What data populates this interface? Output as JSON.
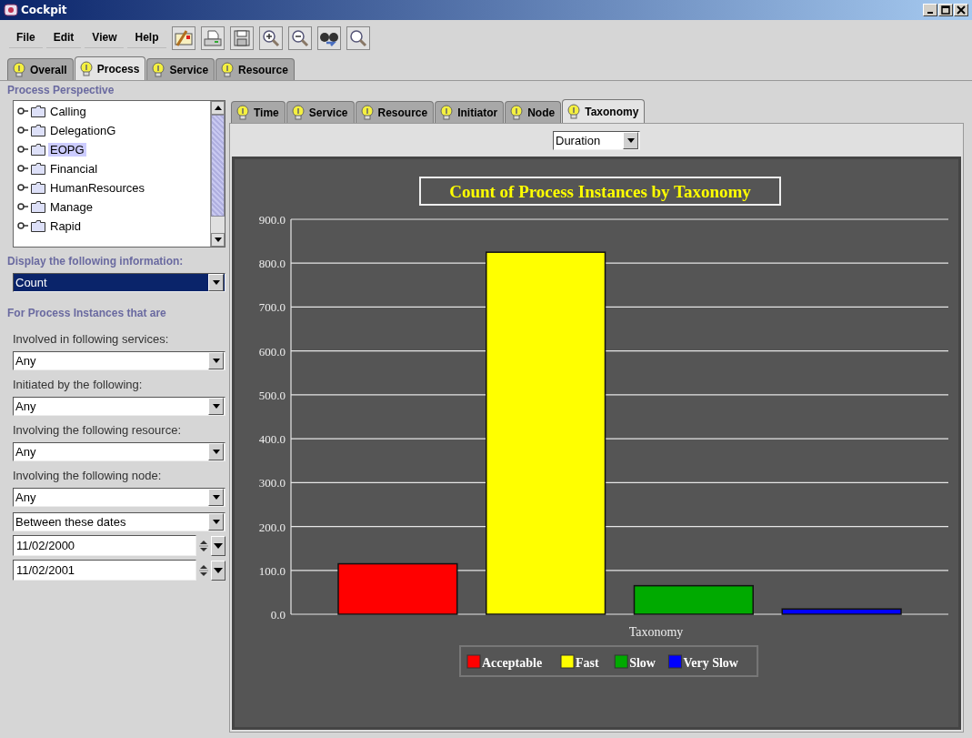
{
  "window": {
    "title": "Cockpit"
  },
  "menu": [
    "File",
    "Edit",
    "View",
    "Help"
  ],
  "tabs": [
    {
      "label": "Overall",
      "selected": false
    },
    {
      "label": "Process",
      "selected": true
    },
    {
      "label": "Service",
      "selected": false
    },
    {
      "label": "Resource",
      "selected": false
    }
  ],
  "perspective": {
    "title": "Process Perspective",
    "items": [
      {
        "label": "Calling",
        "selected": false
      },
      {
        "label": "DelegationG",
        "selected": false
      },
      {
        "label": "EOPG",
        "selected": true
      },
      {
        "label": "Financial",
        "selected": false
      },
      {
        "label": "HumanResources",
        "selected": false
      },
      {
        "label": "Manage",
        "selected": false
      },
      {
        "label": "Rapid",
        "selected": false
      }
    ]
  },
  "display": {
    "label": "Display the following information:",
    "value": "Count"
  },
  "filters": {
    "title": "For Process Instances that are",
    "fields": [
      {
        "kind": "combo",
        "label": "Involved in following services:",
        "value": "Any"
      },
      {
        "kind": "combo",
        "label": "Initiated by the following:",
        "value": "Any"
      },
      {
        "kind": "combo",
        "label": "Involving the following resource:",
        "value": "Any"
      },
      {
        "kind": "combo",
        "label": "Involving the following node:",
        "value": "Any"
      },
      {
        "kind": "combo",
        "value": "Between these dates"
      },
      {
        "kind": "date",
        "value": "11/02/2000"
      },
      {
        "kind": "date",
        "value": "11/02/2001"
      }
    ]
  },
  "subtabs": [
    {
      "label": "Time",
      "selected": false
    },
    {
      "label": "Service",
      "selected": false
    },
    {
      "label": "Resource",
      "selected": false
    },
    {
      "label": "Initiator",
      "selected": false
    },
    {
      "label": "Node",
      "selected": false
    },
    {
      "label": "Taxonomy",
      "selected": true
    }
  ],
  "measure": {
    "value": "Duration"
  },
  "chart_data": {
    "type": "bar",
    "grid": true,
    "legend": true,
    "title": "Count of Process Instances by Taxonomy",
    "xlabel": "Taxonomy",
    "ylim": [
      0,
      900
    ],
    "yticks": [
      {
        "value": 0,
        "label": "0.0"
      },
      {
        "value": 100,
        "label": "100.0"
      },
      {
        "value": 200,
        "label": "200.0"
      },
      {
        "value": 300,
        "label": "300.0"
      },
      {
        "value": 400,
        "label": "400.0"
      },
      {
        "value": 500,
        "label": "500.0"
      },
      {
        "value": 600,
        "label": "600.0"
      },
      {
        "value": 700,
        "label": "700.0"
      },
      {
        "value": 800,
        "label": "800.0"
      },
      {
        "value": 900,
        "label": "900.0"
      }
    ],
    "series": [
      {
        "name": "Acceptable",
        "color": "#ff0000",
        "values": [
          115
        ]
      },
      {
        "name": "Fast",
        "color": "#ffff00",
        "values": [
          825
        ]
      },
      {
        "name": "Slow",
        "color": "#00aa00",
        "values": [
          65
        ]
      },
      {
        "name": "Very Slow",
        "color": "#0000ff",
        "values": [
          12
        ]
      }
    ]
  }
}
